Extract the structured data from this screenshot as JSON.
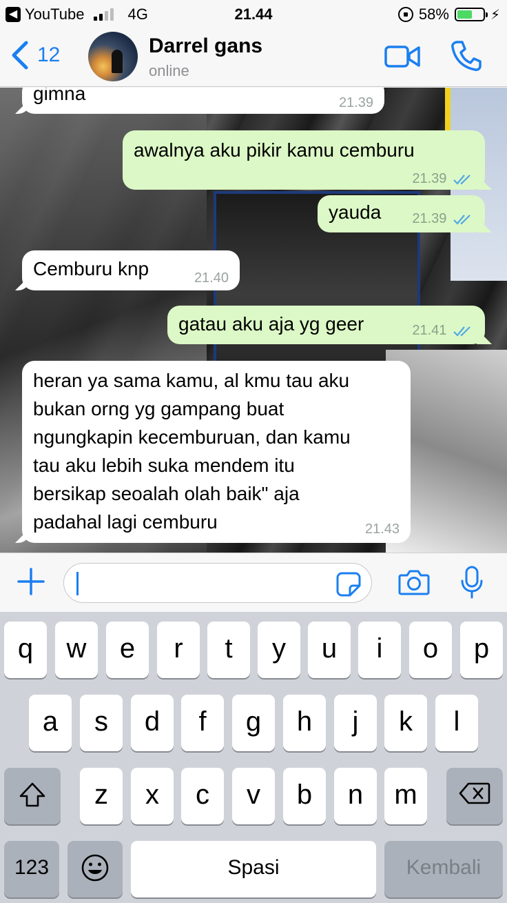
{
  "status_bar": {
    "back_app": "YouTube",
    "network": "4G",
    "time": "21.44",
    "battery": "58%",
    "battery_level": 0.58,
    "signal_bars_on": 2
  },
  "header": {
    "back_count": "12",
    "contact_name": "Darrel gans",
    "contact_status": "online"
  },
  "messages": [
    {
      "direction": "in",
      "text": "gimna",
      "time": "21.39"
    },
    {
      "direction": "out",
      "text": "awalnya aku pikir kamu cemburu",
      "time": "21.39",
      "read": true
    },
    {
      "direction": "out",
      "text": "yauda",
      "time": "21.39",
      "read": true
    },
    {
      "direction": "in",
      "text": "Cemburu knp",
      "time": "21.40"
    },
    {
      "direction": "out",
      "text": "gatau aku aja yg geer",
      "time": "21.41",
      "read": true
    },
    {
      "direction": "in",
      "lines": [
        "heran ya sama kamu, al kmu tau aku",
        "bukan orng yg gampang buat",
        "ngungkapin kecemburuan, dan kamu",
        "tau aku lebih suka mendem itu",
        "bersikap seoalah olah baik\" aja",
        "padahal lagi cemburu"
      ],
      "time": "21.43"
    }
  ],
  "input": {
    "value": "",
    "icons": [
      "plus-icon",
      "sticker-icon",
      "camera-icon",
      "microphone-icon"
    ]
  },
  "keyboard": {
    "row1": [
      "q",
      "w",
      "e",
      "r",
      "t",
      "y",
      "u",
      "i",
      "o",
      "p"
    ],
    "row2": [
      "a",
      "s",
      "d",
      "f",
      "g",
      "h",
      "j",
      "k",
      "l"
    ],
    "row3": [
      "z",
      "x",
      "c",
      "v",
      "b",
      "n",
      "m"
    ],
    "numbers_key": "123",
    "space_key": "Spasi",
    "return_key": "Kembali"
  },
  "colors": {
    "accent": "#1a7ff0",
    "outgoing_bubble": "#dcf8c6",
    "incoming_bubble": "#ffffff",
    "read_ticks": "#4fa8e6"
  }
}
